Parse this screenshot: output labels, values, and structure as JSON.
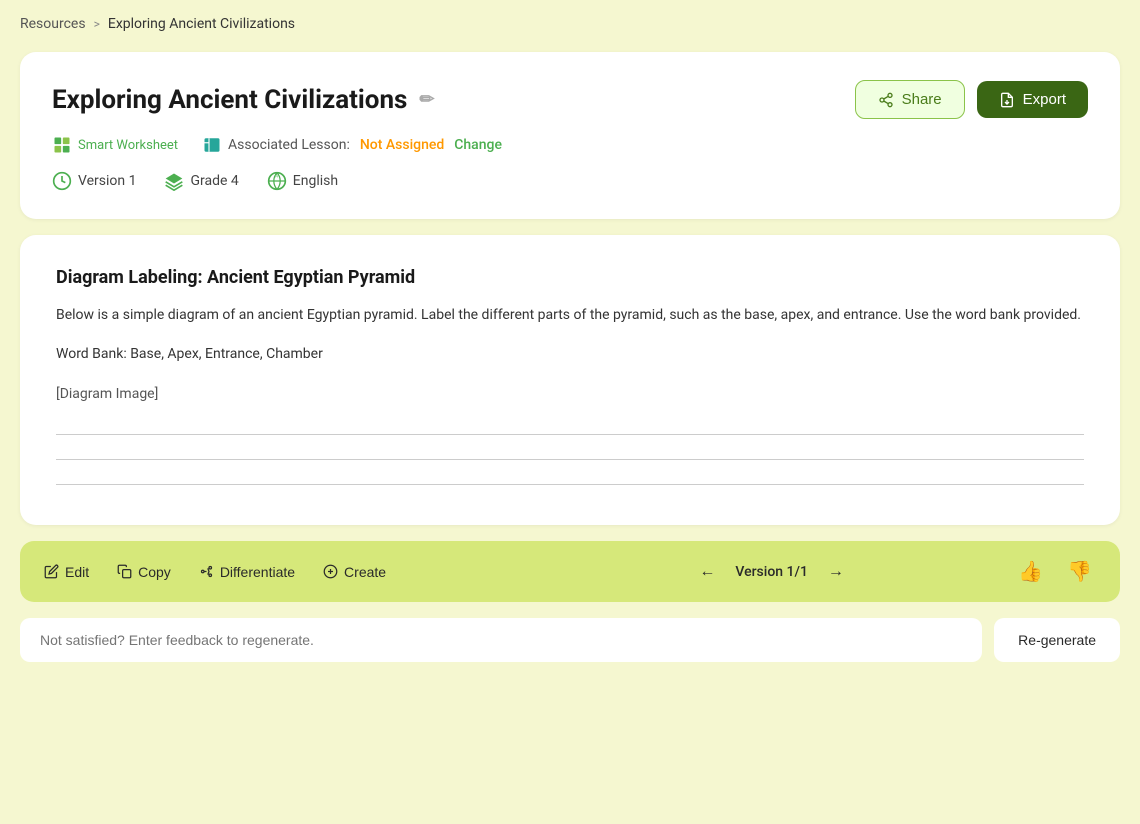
{
  "breadcrumb": {
    "home_label": "Resources",
    "separator": ">",
    "current_label": "Exploring Ancient Civilizations"
  },
  "header": {
    "title": "Exploring Ancient Civilizations",
    "edit_icon": "✏",
    "share_label": "Share",
    "export_label": "Export",
    "meta": {
      "type_label": "Smart Worksheet",
      "lesson_prefix": "Associated Lesson:",
      "lesson_status": "Not Assigned",
      "lesson_change": "Change"
    },
    "version": {
      "version_label": "Version 1",
      "grade_label": "Grade 4",
      "language_label": "English"
    }
  },
  "content": {
    "question_title": "Diagram Labeling: Ancient Egyptian Pyramid",
    "question_body": "Below is a simple diagram of an ancient Egyptian pyramid. Label the different parts of the pyramid, such as the base, apex, and entrance. Use the word bank provided.",
    "word_bank": "Word Bank: Base, Apex, Entrance, Chamber",
    "diagram_placeholder": "[Diagram Image]"
  },
  "toolbar": {
    "edit_label": "Edit",
    "copy_label": "Copy",
    "differentiate_label": "Differentiate",
    "create_label": "Create",
    "version_label": "Version 1/1"
  },
  "feedback": {
    "input_placeholder": "Not satisfied? Enter feedback to regenerate.",
    "regenerate_label": "Re-generate"
  },
  "colors": {
    "background": "#f5f7d0",
    "card_bg": "#ffffff",
    "export_btn": "#3a6614",
    "toolbar_bg": "#d6e87a",
    "not_assigned": "#ff9800",
    "change_color": "#4caf50"
  }
}
